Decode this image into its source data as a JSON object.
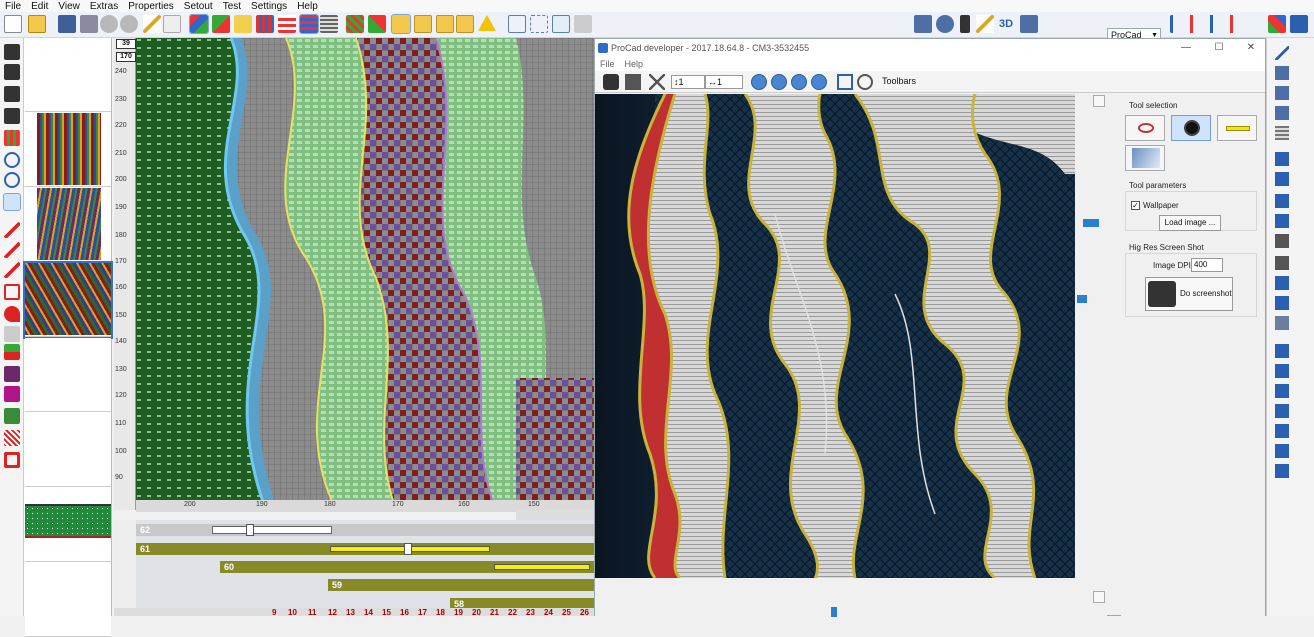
{
  "menu": [
    "File",
    "Edit",
    "View",
    "Extras",
    "Properties",
    "Setout",
    "Test",
    "Settings",
    "Help"
  ],
  "toolbar": {
    "procad_select": "ProCad",
    "label_3d": "3D"
  },
  "ruler": {
    "badge_top": "39",
    "badge_row": "170",
    "vertical_labels": [
      "240",
      "230",
      "220",
      "210",
      "200",
      "190",
      "180",
      "170",
      "160",
      "150",
      "140",
      "130",
      "120",
      "110",
      "100",
      "90"
    ],
    "horizontal_labels": [
      "200",
      "190",
      "180",
      "170",
      "160",
      "150"
    ]
  },
  "timeline": {
    "rows": [
      "62",
      "61",
      "60",
      "59",
      "58"
    ],
    "bottom_labels": [
      "9",
      "10",
      "11",
      "12",
      "13",
      "14",
      "15",
      "16",
      "17",
      "18",
      "19",
      "20",
      "21",
      "22",
      "23",
      "24",
      "25",
      "26"
    ]
  },
  "dev_window": {
    "title": "ProCad developer - 2017.18.64.8 - CM3-3532455",
    "minimize": "—",
    "maximize": "☐",
    "close": "✕",
    "menu": [
      "File",
      "Help"
    ],
    "spin1_value": "1",
    "spin2_value": "1",
    "toolbars_label": "Toolbars",
    "panel": {
      "tool_selection_title": "Tool selection",
      "tool_parameters_title": "Tool parameters",
      "wallpaper_label": "Wallpaper",
      "wallpaper_checked": true,
      "load_image_button": "Load image ...",
      "hires_title": "Hig Res Screen Shot",
      "image_dpi_label": "Image DPI",
      "image_dpi_value": "400",
      "do_screenshot_button": "Do screenshot"
    }
  },
  "colors": {
    "pattern_green": "#1f5e22",
    "lace_navy": "#0c2236",
    "gold": "#c8b43a",
    "timeline_olive": "#888a28",
    "yellow": "#f5f000"
  }
}
